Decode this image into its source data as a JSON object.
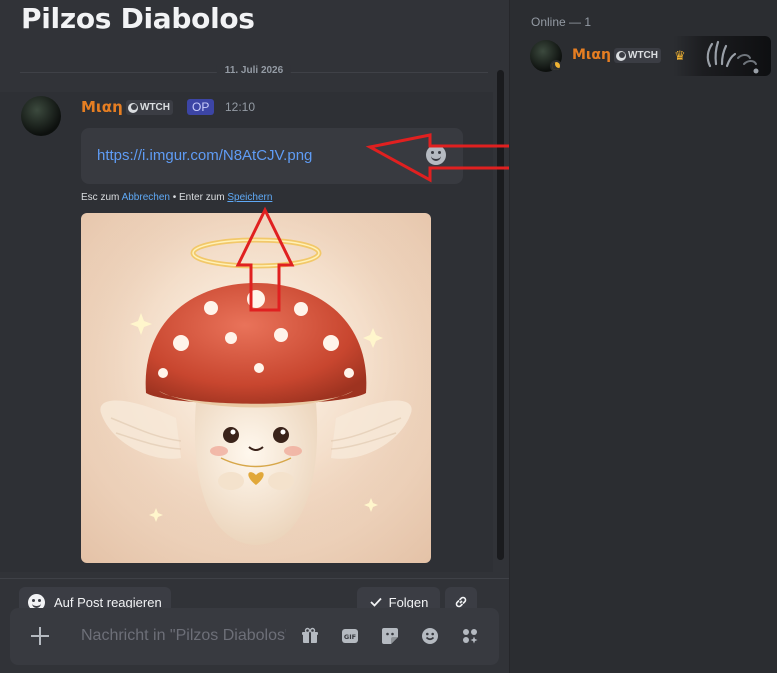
{
  "channel": {
    "title": "Pilzos Diabolos"
  },
  "date_divider": "11. Juli 2026",
  "message": {
    "author": "Μιαη",
    "tag": "WTCH",
    "op_badge": "OP",
    "time": "12:10",
    "edit_value": "https://i.imgur.com/N8AtCJV.png",
    "hint": {
      "esc": "Esc zum ",
      "cancel": "Abbrechen",
      "sep": " • Enter zum ",
      "save": "Speichern"
    }
  },
  "actions": {
    "react": "Auf Post reagieren",
    "follow": "Folgen"
  },
  "composer": {
    "placeholder": "Nachricht in \"Pilzos Diabolos\""
  },
  "members": {
    "heading": "Online — 1",
    "items": [
      {
        "name": "Μιαη",
        "tag": "WTCH"
      }
    ]
  },
  "colors": {
    "author": "#e67e22",
    "link": "#5f9cf5",
    "annotation_arrow": "#e02020",
    "crown": "#f0b232"
  }
}
